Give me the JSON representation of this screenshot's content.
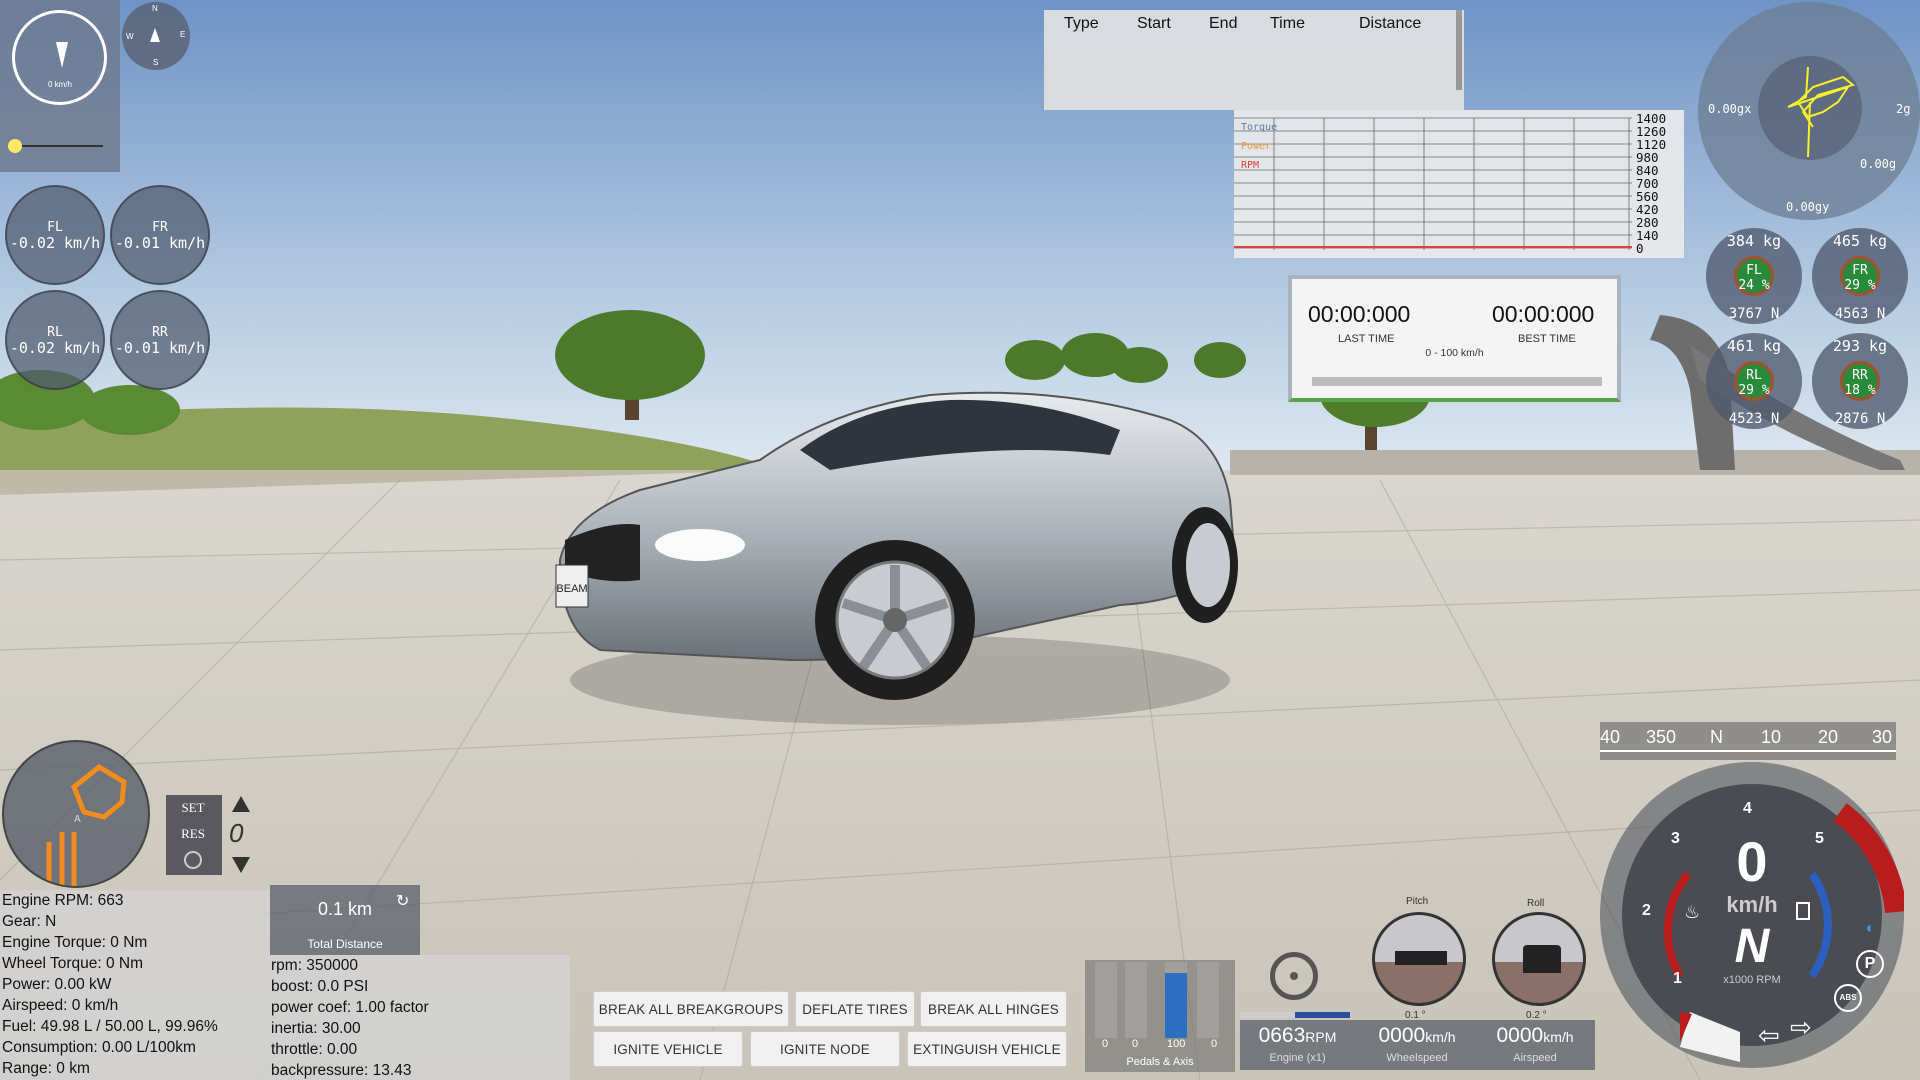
{
  "compass_small": {
    "n": "N",
    "e": "E",
    "w": "W",
    "s": "S"
  },
  "mini_speedo": {
    "speed": "0 km/h"
  },
  "wheel_speeds": [
    {
      "label": "FL",
      "value": "-0.02 km/h"
    },
    {
      "label": "FR",
      "value": "-0.01 km/h"
    },
    {
      "label": "RL",
      "value": "-0.02 km/h"
    },
    {
      "label": "RR",
      "value": "-0.01 km/h"
    }
  ],
  "lap_table": {
    "headers": [
      "Type",
      "Start",
      "End",
      "Time",
      "Distance"
    ]
  },
  "torque_graph": {
    "legend": [
      "Torque",
      "Power",
      "RPM"
    ],
    "legend_colors": [
      "#5a7fa8",
      "#e89a3c",
      "#e04040"
    ],
    "ticks": [
      "1400",
      "1260",
      "1120",
      "980",
      "840",
      "700",
      "560",
      "420",
      "280",
      "140",
      "0"
    ]
  },
  "timer": {
    "last_time": "00:00:000",
    "last_label": "LAST TIME",
    "best_time": "00:00:000",
    "best_label": "BEST TIME",
    "range_label": "0 - 100 km/h"
  },
  "gforce": {
    "x_label": "0.00gx",
    "y_label": "0.00gy",
    "z_label": "0.00g",
    "max_label": "2g"
  },
  "suspension": [
    {
      "pos": "FL",
      "mass": "384 kg",
      "pct": "24 %",
      "force": "3767 N"
    },
    {
      "pos": "FR",
      "mass": "465 kg",
      "pct": "29 %",
      "force": "4563 N"
    },
    {
      "pos": "RL",
      "mass": "461 kg",
      "pct": "29 %",
      "force": "4523 N"
    },
    {
      "pos": "RR",
      "mass": "293 kg",
      "pct": "18 %",
      "force": "2876 N"
    }
  ],
  "heading_tape": [
    "40",
    "350",
    "N",
    "10",
    "20",
    "30"
  ],
  "cruise": {
    "set": "SET",
    "res": "RES",
    "value": "0"
  },
  "engine_info": [
    "Engine RPM: 663",
    "Gear: N",
    "Engine Torque: 0 Nm",
    "Wheel Torque: 0 Nm",
    "Power: 0.00 kW",
    "Airspeed: 0 km/h",
    "Fuel: 49.98 L / 50.00 L, 99.96%",
    "Consumption: 0.00 L/100km",
    "Range: 0 km"
  ],
  "trip": {
    "distance": "0.1 km",
    "label": "Total Distance"
  },
  "turbo_info": [
    "rpm: 350000",
    "boost: 0.0 PSI",
    "power coef: 1.00 factor",
    "inertia: 30.00",
    "throttle: 0.00",
    "backpressure: 13.43"
  ],
  "buttons": {
    "break_breakgroups": "BREAK ALL BREAKGROUPS",
    "deflate_tires": "DEFLATE TIRES",
    "break_hinges": "BREAK ALL HINGES",
    "ignite_vehicle": "IGNITE VEHICLE",
    "ignite_node": "IGNITE NODE",
    "extinguish_vehicle": "EXTINGUISH VEHICLE"
  },
  "pedals": {
    "values": [
      "0",
      "0",
      "100",
      "0"
    ],
    "label": "Pedals & Axis",
    "brake_level": 0.85
  },
  "pitch": {
    "label": "Pitch",
    "value": "0.1 °"
  },
  "roll": {
    "label": "Roll",
    "value": "0.2 °"
  },
  "readouts": [
    {
      "value": "0663",
      "unit": "RPM",
      "label": "Engine (x1)"
    },
    {
      "value": "0000",
      "unit": "km/h",
      "label": "Wheelspeed"
    },
    {
      "value": "0000",
      "unit": "km/h",
      "label": "Airspeed"
    }
  ],
  "dash": {
    "speed": "0",
    "speed_unit": "km/h",
    "gear": "N",
    "rpm_unit": "x1000 RPM",
    "rpm_ticks": [
      "1",
      "2",
      "3",
      "4",
      "5"
    ],
    "park": "P",
    "abs": "ABS",
    "redline_color": "#b81c1c",
    "cool_color": "#2a5fbf"
  },
  "license_plate": "BEAM"
}
